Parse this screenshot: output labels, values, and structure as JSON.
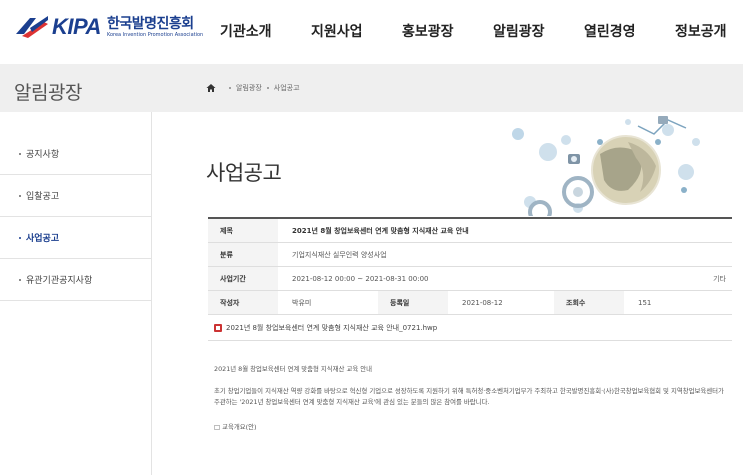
{
  "header": {
    "logo_text": "KIPA",
    "logo_kor": "한국발명진흥회",
    "logo_eng": "Korea Invention Promotion Association",
    "nav": [
      "기관소개",
      "지원사업",
      "홍보광장",
      "알림광장",
      "열린경영",
      "정보공개"
    ]
  },
  "band": {
    "title": "알림광장",
    "breadcrumb": [
      "알림광장",
      "사업공고"
    ]
  },
  "sidebar": {
    "items": [
      {
        "label": "공지사항",
        "active": false
      },
      {
        "label": "입찰공고",
        "active": false
      },
      {
        "label": "사업공고",
        "active": true
      },
      {
        "label": "유관기관공지사항",
        "active": false
      }
    ]
  },
  "main": {
    "title": "사업공고",
    "table": {
      "subject_label": "제목",
      "subject": "2021년 8월 창업보육센터 연계 맞춤형 지식재산 교육 안내",
      "category_label": "분류",
      "category": "기업지식재산 실무인력 양성사업",
      "period_label": "사업기간",
      "period": "2021-08-12 00:00 ~ 2021-08-31 00:00",
      "period_extra": "기타",
      "author_label": "작성자",
      "author": "박유미",
      "date_label": "등록일",
      "date": "2021-08-12",
      "views_label": "조회수",
      "views": "151",
      "file": "2021년 8월 창업보육센터 연계 맞춤형 지식재산 교육 안내_0721.hwp"
    },
    "body": [
      "2021년 8월 창업보육센터 연계 맞춤형 지식재산 교육 안내",
      "초기 창업기업들이 지식재산 역량 강화를 바탕으로 혁신형 기업으로 성장하도록 지원하기 위해 특허청·중소벤처기업부가 주최하고 한국발명진흥회·(사)한국창업보육협회 및 지역창업보육센터가 주관하는 '2021년 창업보육센터 연계 맞춤형 지식재산 교육'에 관심 있는 분들의 많은 참여를 바랍니다.",
      "□ 교육개요(안)"
    ]
  },
  "colors": {
    "brand": "#1b3f8f",
    "band": "#efefef"
  }
}
